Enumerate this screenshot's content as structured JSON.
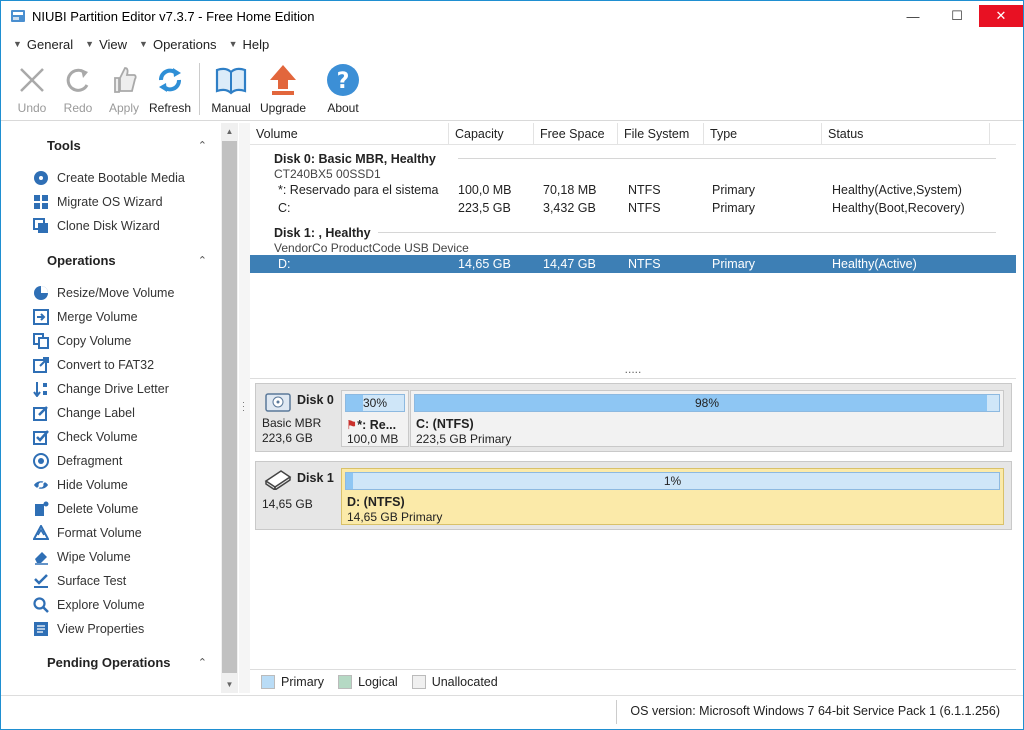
{
  "window": {
    "title": "NIUBI Partition Editor v7.3.7 - Free Home Edition",
    "minimize": "—",
    "maximize": "☐",
    "close": "✕"
  },
  "menu": [
    "General",
    "View",
    "Operations",
    "Help"
  ],
  "toolbar": [
    {
      "label": "Undo",
      "icon": "undo-icon",
      "enabled": false
    },
    {
      "label": "Redo",
      "icon": "redo-icon",
      "enabled": false
    },
    {
      "label": "Apply",
      "icon": "apply-icon",
      "enabled": false
    },
    {
      "label": "Refresh",
      "icon": "refresh-icon",
      "enabled": true
    },
    {
      "label": "Manual",
      "icon": "book-icon",
      "enabled": true
    },
    {
      "label": "Upgrade",
      "icon": "upgrade-arrow-icon",
      "enabled": true
    },
    {
      "label": "About",
      "icon": "question-icon",
      "enabled": true
    }
  ],
  "sidebar": {
    "tools_header": "Tools",
    "tools": [
      "Create Bootable Media",
      "Migrate OS Wizard",
      "Clone Disk Wizard"
    ],
    "operations_header": "Operations",
    "operations": [
      "Resize/Move Volume",
      "Merge Volume",
      "Copy Volume",
      "Convert to FAT32",
      "Change Drive Letter",
      "Change Label",
      "Check Volume",
      "Defragment",
      "Hide Volume",
      "Delete Volume",
      "Format Volume",
      "Wipe Volume",
      "Surface Test",
      "Explore Volume",
      "View Properties"
    ],
    "pending_header": "Pending Operations"
  },
  "table": {
    "headers": [
      "Volume",
      "Capacity",
      "Free Space",
      "File System",
      "Type",
      "Status"
    ],
    "disks": [
      {
        "name": "Disk 0: Basic MBR, Healthy",
        "model": "CT240BX5 00SSD1",
        "partitions": [
          {
            "volume": "*: Reservado para el sistema",
            "capacity": "100,0 MB",
            "free": "70,18 MB",
            "fs": "NTFS",
            "type": "Primary",
            "status": "Healthy(Active,System)"
          },
          {
            "volume": "C:",
            "capacity": "223,5 GB",
            "free": "3,432 GB",
            "fs": "NTFS",
            "type": "Primary",
            "status": "Healthy(Boot,Recovery)"
          }
        ]
      },
      {
        "name": "Disk 1: , Healthy",
        "model": "VendorCo ProductCode USB Device",
        "partitions": [
          {
            "volume": "D:",
            "capacity": "14,65 GB",
            "free": "14,47 GB",
            "fs": "NTFS",
            "type": "Primary",
            "status": "Healthy(Active)"
          }
        ]
      }
    ],
    "resize_handle": "....."
  },
  "diskmap": {
    "disk0": {
      "name": "Disk 0",
      "type": "Basic MBR",
      "size": "223,6 GB",
      "p1": {
        "pct_label": "30%",
        "used": 0.3,
        "name": "*: Re...",
        "size": "100,0 MB"
      },
      "p2": {
        "pct_label": "98%",
        "used": 0.98,
        "name": "C: (NTFS)",
        "size": "223,5 GB Primary"
      }
    },
    "disk1": {
      "name": "Disk 1",
      "size": "14,65 GB",
      "p1": {
        "pct_label": "1%",
        "used": 0.01,
        "name": "D: (NTFS)",
        "size": "14,65 GB Primary"
      }
    }
  },
  "legend": [
    "Primary",
    "Logical",
    "Unallocated"
  ],
  "legend_colors": [
    "#b9dcf6",
    "#b5d9c4",
    "#f0f0f0"
  ],
  "status": "OS version: Microsoft Windows 7  64-bit Service Pack 1 (6.1.1.256)"
}
